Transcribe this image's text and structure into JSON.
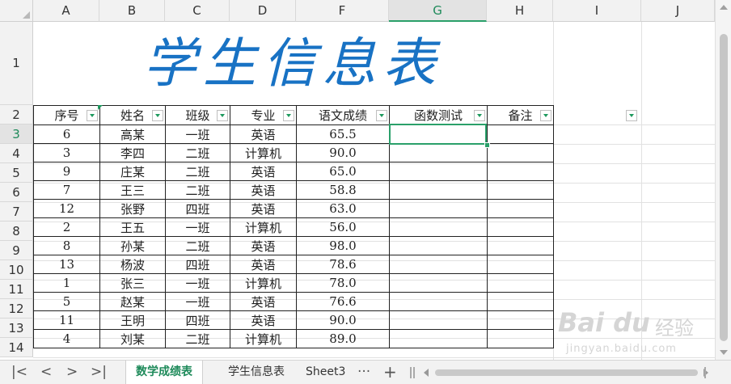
{
  "columns": [
    "A",
    "B",
    "C",
    "D",
    "F",
    "G",
    "H",
    "I",
    "J"
  ],
  "rows": [
    "1",
    "2",
    "3",
    "4",
    "5",
    "6",
    "7",
    "8",
    "9",
    "10",
    "11",
    "12",
    "13",
    "14"
  ],
  "selected_column": "G",
  "selected_row": "3",
  "title": "学生信息表",
  "headers": [
    "序号",
    "姓名",
    "班级",
    "专业",
    "语文成绩",
    "函数测试",
    "备注"
  ],
  "table_rows": [
    [
      "6",
      "高某",
      "一班",
      "英语",
      "65.5",
      "",
      ""
    ],
    [
      "3",
      "李四",
      "二班",
      "计算机",
      "90.0",
      "",
      ""
    ],
    [
      "9",
      "庄某",
      "二班",
      "英语",
      "65.0",
      "",
      ""
    ],
    [
      "7",
      "王三",
      "二班",
      "英语",
      "58.8",
      "",
      ""
    ],
    [
      "12",
      "张野",
      "四班",
      "英语",
      "63.0",
      "",
      ""
    ],
    [
      "2",
      "王五",
      "一班",
      "计算机",
      "56.0",
      "",
      ""
    ],
    [
      "8",
      "孙某",
      "二班",
      "英语",
      "98.0",
      "",
      ""
    ],
    [
      "13",
      "杨波",
      "四班",
      "英语",
      "78.6",
      "",
      ""
    ],
    [
      "1",
      "张三",
      "一班",
      "计算机",
      "78.0",
      "",
      ""
    ],
    [
      "5",
      "赵某",
      "一班",
      "英语",
      "76.6",
      "",
      ""
    ],
    [
      "11",
      "王明",
      "四班",
      "英语",
      "90.0",
      "",
      ""
    ],
    [
      "4",
      "刘某",
      "二班",
      "计算机",
      "89.0",
      "",
      ""
    ]
  ],
  "tabs": [
    {
      "label": "数学成绩表",
      "active": true
    },
    {
      "label": "学生信息表",
      "active": false
    },
    {
      "label": "Sheet3",
      "active": false
    }
  ],
  "nav": {
    "first": "|<",
    "prev": "<",
    "next": ">",
    "last": ">|",
    "more": "···",
    "add": "+"
  },
  "watermark": {
    "logo": "Bai du",
    "text": "经验",
    "url": "jingyan.baidu.com"
  },
  "colors": {
    "accent": "#1e8a5a",
    "title": "#1872c4"
  }
}
